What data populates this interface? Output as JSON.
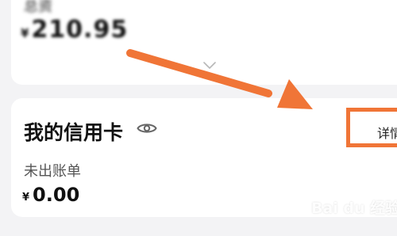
{
  "top_card": {
    "label": "总资",
    "currency": "¥",
    "amount": "210.95"
  },
  "credit_card": {
    "title": "我的信用卡",
    "details_label": "详情",
    "status": "未出账单",
    "currency": "¥",
    "amount": "0.00"
  },
  "watermark": {
    "text": "Bai du 经验"
  },
  "colors": {
    "accent": "#f07537",
    "background": "#f3f3f5",
    "card": "#ffffff"
  },
  "icons": {
    "eye": "eye-icon",
    "chevron": "chevron-down-icon",
    "arrow": "annotation-arrow-icon"
  }
}
